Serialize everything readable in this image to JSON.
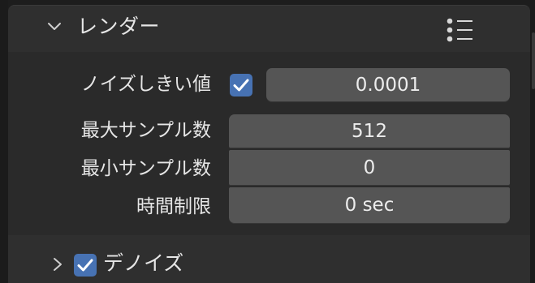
{
  "panel": {
    "title": "レンダー",
    "rows": [
      {
        "label": "ノイズしきい値",
        "checked": true,
        "value": "0.0001"
      },
      {
        "label": "最大サンプル数",
        "value": "512"
      },
      {
        "label": "最小サンプル数",
        "value": "0"
      },
      {
        "label": "時間制限",
        "value": "0 sec"
      }
    ]
  },
  "subpanel": {
    "title": "デノイズ",
    "checked": true
  },
  "colors": {
    "checkbox_accent": "#4772b3",
    "field_bg": "#555555",
    "panel_bg": "#2a2a2a",
    "header_bg": "#2f2f2f"
  }
}
